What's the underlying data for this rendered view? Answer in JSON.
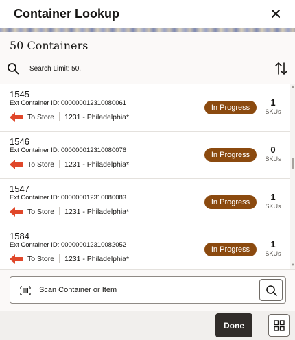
{
  "header": {
    "title": "Container Lookup"
  },
  "subheader": {
    "count_title": "50 Containers",
    "search_limit": "Search Limit: 50."
  },
  "containers": [
    {
      "id": "1545",
      "ext_id": "Ext Container ID: 000000012310080061",
      "direction": "To Store",
      "store": "1231 - Philadelphia*",
      "status": "In Progress",
      "sku_count": "1",
      "sku_label": "SKUs"
    },
    {
      "id": "1546",
      "ext_id": "Ext Container ID: 000000012310080076",
      "direction": "To Store",
      "store": "1231 - Philadelphia*",
      "status": "In Progress",
      "sku_count": "0",
      "sku_label": "SKUs"
    },
    {
      "id": "1547",
      "ext_id": "Ext Container ID: 000000012310080083",
      "direction": "To Store",
      "store": "1231 - Philadelphia*",
      "status": "In Progress",
      "sku_count": "1",
      "sku_label": "SKUs"
    },
    {
      "id": "1584",
      "ext_id": "Ext Container ID: 000000012310082052",
      "direction": "To Store",
      "store": "1231 - Philadelphia*",
      "status": "In Progress",
      "sku_count": "1",
      "sku_label": "SKUs"
    }
  ],
  "scan": {
    "placeholder": "Scan Container or Item"
  },
  "footer": {
    "done_label": "Done"
  },
  "colors": {
    "status_badge": "#8b4a0f",
    "direction_arrow": "#e0472a",
    "done_button": "#312d2a"
  },
  "icons": {
    "close": "close-icon",
    "search": "search-icon",
    "sort": "sort-arrows-icon",
    "arrow": "arrow-left-icon",
    "barcode": "barcode-icon",
    "grid": "grid-icon"
  }
}
